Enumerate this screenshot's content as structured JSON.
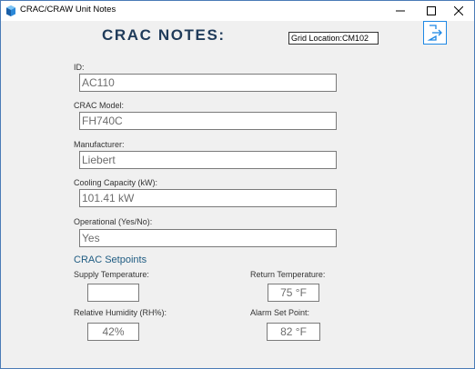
{
  "window": {
    "title": "CRAC/CRAW Unit Notes",
    "app_icon": "app-icon",
    "controls": [
      "minimize-icon",
      "maximize-icon",
      "close-icon"
    ]
  },
  "header": {
    "title": "CRAC NOTES:",
    "grid_location": "Grid Location:CM102",
    "exit_icon": "exit-icon"
  },
  "fields": [
    {
      "label": "ID:",
      "value": "AC110"
    },
    {
      "label": "CRAC Model:",
      "value": "FH740C"
    },
    {
      "label": "Manufacturer:",
      "value": "Liebert"
    },
    {
      "label": "Cooling Capacity (kW):",
      "value": "101.41 kW"
    },
    {
      "label": "Operational (Yes/No):",
      "value": "Yes"
    }
  ],
  "setpoints": {
    "title": "CRAC Setpoints",
    "supply_temperature": {
      "label": "Supply Temperature:",
      "value": ""
    },
    "return_temperature": {
      "label": "Return Temperature:",
      "value": "75 °F"
    },
    "relative_humidity": {
      "label": "Relative Humidity (RH%):",
      "value": "42%"
    },
    "alarm_set_point": {
      "label": "Alarm Set Point:",
      "value": "82 °F"
    }
  },
  "colors": {
    "heading": "#1f3b5a",
    "section_title": "#1f5c82",
    "exit_accent": "#1e88e5",
    "window_border": "#4a7bb7"
  }
}
